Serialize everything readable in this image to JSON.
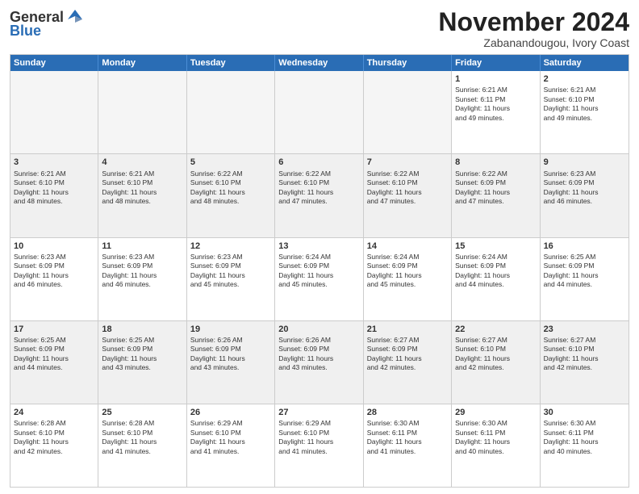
{
  "logo": {
    "general": "General",
    "blue": "Blue"
  },
  "title": "November 2024",
  "location": "Zabanandougou, Ivory Coast",
  "header_days": [
    "Sunday",
    "Monday",
    "Tuesday",
    "Wednesday",
    "Thursday",
    "Friday",
    "Saturday"
  ],
  "rows": [
    [
      {
        "day": "",
        "info": "",
        "empty": true
      },
      {
        "day": "",
        "info": "",
        "empty": true
      },
      {
        "day": "",
        "info": "",
        "empty": true
      },
      {
        "day": "",
        "info": "",
        "empty": true
      },
      {
        "day": "",
        "info": "",
        "empty": true
      },
      {
        "day": "1",
        "info": "Sunrise: 6:21 AM\nSunset: 6:11 PM\nDaylight: 11 hours\nand 49 minutes.",
        "empty": false,
        "shaded": false
      },
      {
        "day": "2",
        "info": "Sunrise: 6:21 AM\nSunset: 6:10 PM\nDaylight: 11 hours\nand 49 minutes.",
        "empty": false,
        "shaded": false
      }
    ],
    [
      {
        "day": "3",
        "info": "Sunrise: 6:21 AM\nSunset: 6:10 PM\nDaylight: 11 hours\nand 48 minutes.",
        "empty": false,
        "shaded": true
      },
      {
        "day": "4",
        "info": "Sunrise: 6:21 AM\nSunset: 6:10 PM\nDaylight: 11 hours\nand 48 minutes.",
        "empty": false,
        "shaded": true
      },
      {
        "day": "5",
        "info": "Sunrise: 6:22 AM\nSunset: 6:10 PM\nDaylight: 11 hours\nand 48 minutes.",
        "empty": false,
        "shaded": true
      },
      {
        "day": "6",
        "info": "Sunrise: 6:22 AM\nSunset: 6:10 PM\nDaylight: 11 hours\nand 47 minutes.",
        "empty": false,
        "shaded": true
      },
      {
        "day": "7",
        "info": "Sunrise: 6:22 AM\nSunset: 6:10 PM\nDaylight: 11 hours\nand 47 minutes.",
        "empty": false,
        "shaded": true
      },
      {
        "day": "8",
        "info": "Sunrise: 6:22 AM\nSunset: 6:09 PM\nDaylight: 11 hours\nand 47 minutes.",
        "empty": false,
        "shaded": true
      },
      {
        "day": "9",
        "info": "Sunrise: 6:23 AM\nSunset: 6:09 PM\nDaylight: 11 hours\nand 46 minutes.",
        "empty": false,
        "shaded": true
      }
    ],
    [
      {
        "day": "10",
        "info": "Sunrise: 6:23 AM\nSunset: 6:09 PM\nDaylight: 11 hours\nand 46 minutes.",
        "empty": false,
        "shaded": false
      },
      {
        "day": "11",
        "info": "Sunrise: 6:23 AM\nSunset: 6:09 PM\nDaylight: 11 hours\nand 46 minutes.",
        "empty": false,
        "shaded": false
      },
      {
        "day": "12",
        "info": "Sunrise: 6:23 AM\nSunset: 6:09 PM\nDaylight: 11 hours\nand 45 minutes.",
        "empty": false,
        "shaded": false
      },
      {
        "day": "13",
        "info": "Sunrise: 6:24 AM\nSunset: 6:09 PM\nDaylight: 11 hours\nand 45 minutes.",
        "empty": false,
        "shaded": false
      },
      {
        "day": "14",
        "info": "Sunrise: 6:24 AM\nSunset: 6:09 PM\nDaylight: 11 hours\nand 45 minutes.",
        "empty": false,
        "shaded": false
      },
      {
        "day": "15",
        "info": "Sunrise: 6:24 AM\nSunset: 6:09 PM\nDaylight: 11 hours\nand 44 minutes.",
        "empty": false,
        "shaded": false
      },
      {
        "day": "16",
        "info": "Sunrise: 6:25 AM\nSunset: 6:09 PM\nDaylight: 11 hours\nand 44 minutes.",
        "empty": false,
        "shaded": false
      }
    ],
    [
      {
        "day": "17",
        "info": "Sunrise: 6:25 AM\nSunset: 6:09 PM\nDaylight: 11 hours\nand 44 minutes.",
        "empty": false,
        "shaded": true
      },
      {
        "day": "18",
        "info": "Sunrise: 6:25 AM\nSunset: 6:09 PM\nDaylight: 11 hours\nand 43 minutes.",
        "empty": false,
        "shaded": true
      },
      {
        "day": "19",
        "info": "Sunrise: 6:26 AM\nSunset: 6:09 PM\nDaylight: 11 hours\nand 43 minutes.",
        "empty": false,
        "shaded": true
      },
      {
        "day": "20",
        "info": "Sunrise: 6:26 AM\nSunset: 6:09 PM\nDaylight: 11 hours\nand 43 minutes.",
        "empty": false,
        "shaded": true
      },
      {
        "day": "21",
        "info": "Sunrise: 6:27 AM\nSunset: 6:09 PM\nDaylight: 11 hours\nand 42 minutes.",
        "empty": false,
        "shaded": true
      },
      {
        "day": "22",
        "info": "Sunrise: 6:27 AM\nSunset: 6:10 PM\nDaylight: 11 hours\nand 42 minutes.",
        "empty": false,
        "shaded": true
      },
      {
        "day": "23",
        "info": "Sunrise: 6:27 AM\nSunset: 6:10 PM\nDaylight: 11 hours\nand 42 minutes.",
        "empty": false,
        "shaded": true
      }
    ],
    [
      {
        "day": "24",
        "info": "Sunrise: 6:28 AM\nSunset: 6:10 PM\nDaylight: 11 hours\nand 42 minutes.",
        "empty": false,
        "shaded": false
      },
      {
        "day": "25",
        "info": "Sunrise: 6:28 AM\nSunset: 6:10 PM\nDaylight: 11 hours\nand 41 minutes.",
        "empty": false,
        "shaded": false
      },
      {
        "day": "26",
        "info": "Sunrise: 6:29 AM\nSunset: 6:10 PM\nDaylight: 11 hours\nand 41 minutes.",
        "empty": false,
        "shaded": false
      },
      {
        "day": "27",
        "info": "Sunrise: 6:29 AM\nSunset: 6:10 PM\nDaylight: 11 hours\nand 41 minutes.",
        "empty": false,
        "shaded": false
      },
      {
        "day": "28",
        "info": "Sunrise: 6:30 AM\nSunset: 6:11 PM\nDaylight: 11 hours\nand 41 minutes.",
        "empty": false,
        "shaded": false
      },
      {
        "day": "29",
        "info": "Sunrise: 6:30 AM\nSunset: 6:11 PM\nDaylight: 11 hours\nand 40 minutes.",
        "empty": false,
        "shaded": false
      },
      {
        "day": "30",
        "info": "Sunrise: 6:30 AM\nSunset: 6:11 PM\nDaylight: 11 hours\nand 40 minutes.",
        "empty": false,
        "shaded": false
      }
    ]
  ]
}
